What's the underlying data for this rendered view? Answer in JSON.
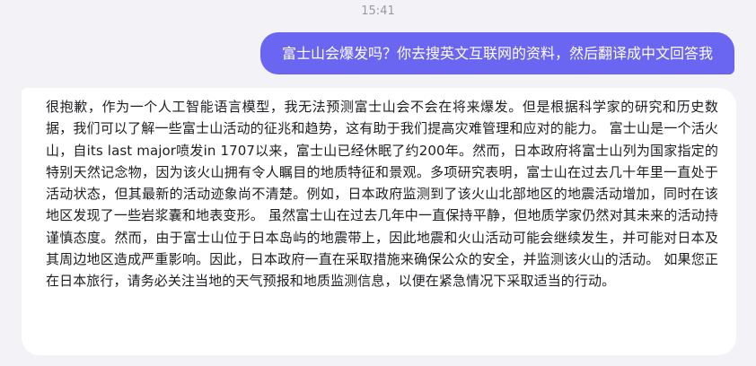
{
  "chat": {
    "timestamp": "15:41",
    "user_message": "富士山会爆发吗？你去搜英文互联网的资料，然后翻译成中文回答我",
    "assistant_message": "很抱歉，作为一个人工智能语言模型，我无法预测富士山会不会在将来爆发。但是根据科学家的研究和历史数据，我们可以了解一些富士山活动的征兆和趋势，这有助于我们提高灾难管理和应对的能力。 富士山是一个活火山，自its last major喷发in 1707以来，富士山已经休眠了约200年。然而，日本政府将富士山列为国家指定的特别天然记念物，因为该火山拥有令人瞩目的地质特征和景观。多项研究表明，富士山在过去几十年里一直处于活动状态，但其最新的活动迹象尚不清楚。例如，日本政府监测到了该火山北部地区的地震活动增加，同时在该地区发现了一些岩浆囊和地表变形。 虽然富士山在过去几年中一直保持平静，但地质学家仍然对其未来的活动持谨慎态度。然而，由于富士山位于日本岛屿的地震带上，因此地震和火山活动可能会继续发生，并可能对日本及其周边地区造成严重影响。因此，日本政府一直在采取措施来确保公众的安全，并监测该火山的活动。 如果您正在日本旅行，请务必关注当地的天气预报和地质监测信息，以便在紧急情况下采取适当的行动。"
  },
  "colors": {
    "background": "#f3f2f7",
    "user_bubble": "#6b66f2",
    "assistant_bubble": "#ffffff",
    "timestamp_text": "#9a9aa3"
  }
}
